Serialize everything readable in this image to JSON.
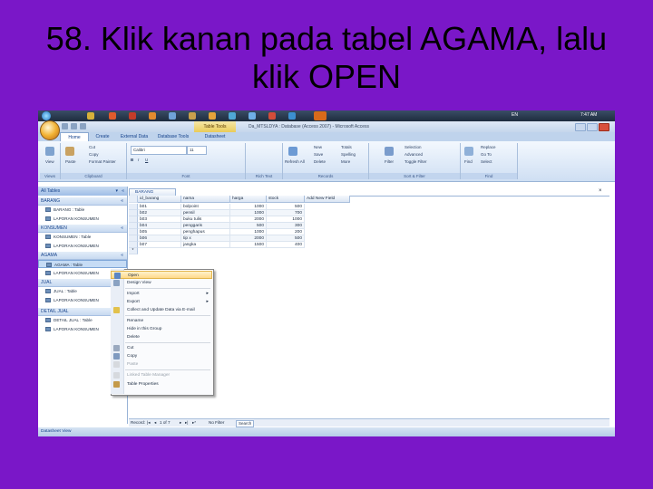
{
  "slide": {
    "title_line1": "58. Klik kanan pada tabel AGAMA, lalu",
    "title_line2": "klik OPEN"
  },
  "taskbar": {
    "lang": "EN",
    "clock": "7:47 AM"
  },
  "window": {
    "title": "Da_MTSLDYA : Database (Access 2007) - Microsoft Access",
    "context_tab": "Table Tools"
  },
  "ribbon": {
    "tabs": [
      "Home",
      "Create",
      "External Data",
      "Database Tools",
      "Datasheet"
    ],
    "groups": [
      "Views",
      "Clipboard",
      "Font",
      "Rich Text",
      "Records",
      "Sort & Filter",
      "Find"
    ],
    "view_label": "View",
    "paste_label": "Paste",
    "cut_label": "Cut",
    "copy_label": "Copy",
    "format_painter_label": "Format Painter",
    "font_name": "Calibri",
    "font_size": "11",
    "refresh_label": "Refresh All",
    "new_label": "New",
    "save_label": "Save",
    "delete_label": "Delete",
    "totals_label": "Totals",
    "spelling_label": "Spelling",
    "more_label": "More",
    "filter_label": "Filter",
    "selection_label": "Selection",
    "advanced_label": "Advanced",
    "toggle_filter_label": "Toggle Filter",
    "find_label": "Find",
    "replace_label": "Replace",
    "goto_label": "Go To",
    "select_label": "Select"
  },
  "nav": {
    "header": "All Tables",
    "groups": [
      {
        "name": "BARANG",
        "items": [
          "BARANG : Table",
          "LAPORAN KONSUMEN"
        ]
      },
      {
        "name": "KONSUMEN",
        "items": [
          "KONSUMEN : Table",
          "LAPORAN KONSUMEN"
        ]
      },
      {
        "name": "AGAMA",
        "items": [
          "AGAMA : Table",
          "LAPORAN KONSUMEN"
        ]
      },
      {
        "name": "JUAL",
        "items": [
          "JUAL : Table",
          "LAPORAN KONSUMEN"
        ]
      },
      {
        "name": "DETAIL JUAL",
        "items": [
          "DETAIL JUAL : Table",
          "LAPORAN KONSUMEN"
        ]
      }
    ]
  },
  "table": {
    "tab_name": "BARANG",
    "columns": [
      "id_barang",
      "nama",
      "harga",
      "stock",
      "Add New Field"
    ],
    "rows": [
      [
        "b01",
        "bolpoint",
        "1000",
        "500"
      ],
      [
        "b02",
        "pensil",
        "1000",
        "700"
      ],
      [
        "b03",
        "buku tulis",
        "2000",
        "1000"
      ],
      [
        "b04",
        "penggaris",
        "500",
        "300"
      ],
      [
        "b05",
        "penghapus",
        "1000",
        "200"
      ],
      [
        "b06",
        "tip x",
        "2000",
        "500"
      ],
      [
        "b07",
        "jangka",
        "1500",
        "400"
      ]
    ]
  },
  "context_menu": {
    "items": [
      "Open",
      "Design View",
      "Import",
      "Export",
      "Collect and Update Data via E-mail",
      "Rename",
      "Hide in this Group",
      "Delete",
      "Cut",
      "Copy",
      "Paste",
      "Linked Table Manager",
      "Table Properties"
    ],
    "highlighted": "Open"
  },
  "record_nav": {
    "record_label": "Record:",
    "position": "1 of 7",
    "filter": "No Filter",
    "search": "Search"
  },
  "status": {
    "text": "Datasheet View"
  }
}
